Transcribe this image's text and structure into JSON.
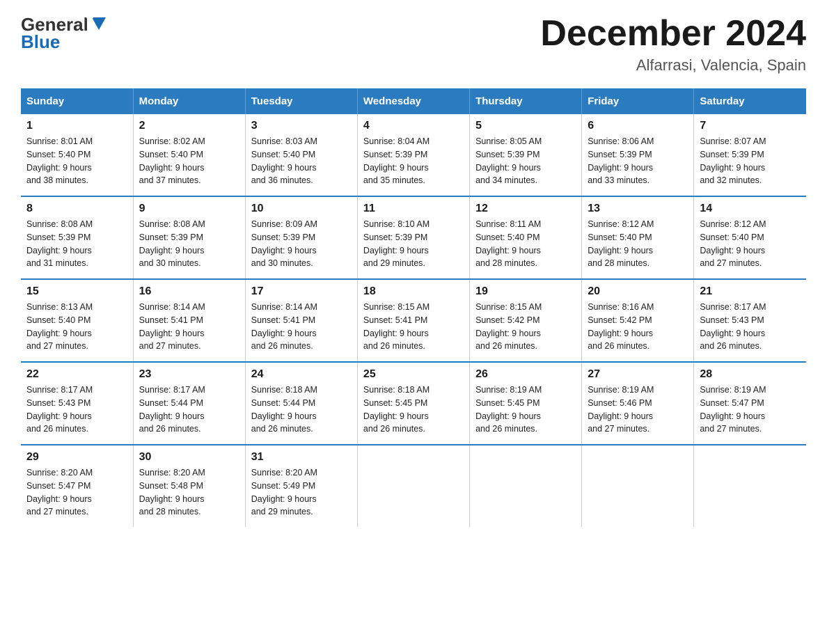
{
  "logo": {
    "general": "General",
    "blue": "Blue"
  },
  "title": {
    "month_year": "December 2024",
    "location": "Alfarrasi, Valencia, Spain"
  },
  "days_of_week": [
    "Sunday",
    "Monday",
    "Tuesday",
    "Wednesday",
    "Thursday",
    "Friday",
    "Saturday"
  ],
  "weeks": [
    [
      {
        "day": "1",
        "sunrise": "8:01 AM",
        "sunset": "5:40 PM",
        "daylight": "9 hours and 38 minutes."
      },
      {
        "day": "2",
        "sunrise": "8:02 AM",
        "sunset": "5:40 PM",
        "daylight": "9 hours and 37 minutes."
      },
      {
        "day": "3",
        "sunrise": "8:03 AM",
        "sunset": "5:40 PM",
        "daylight": "9 hours and 36 minutes."
      },
      {
        "day": "4",
        "sunrise": "8:04 AM",
        "sunset": "5:39 PM",
        "daylight": "9 hours and 35 minutes."
      },
      {
        "day": "5",
        "sunrise": "8:05 AM",
        "sunset": "5:39 PM",
        "daylight": "9 hours and 34 minutes."
      },
      {
        "day": "6",
        "sunrise": "8:06 AM",
        "sunset": "5:39 PM",
        "daylight": "9 hours and 33 minutes."
      },
      {
        "day": "7",
        "sunrise": "8:07 AM",
        "sunset": "5:39 PM",
        "daylight": "9 hours and 32 minutes."
      }
    ],
    [
      {
        "day": "8",
        "sunrise": "8:08 AM",
        "sunset": "5:39 PM",
        "daylight": "9 hours and 31 minutes."
      },
      {
        "day": "9",
        "sunrise": "8:08 AM",
        "sunset": "5:39 PM",
        "daylight": "9 hours and 30 minutes."
      },
      {
        "day": "10",
        "sunrise": "8:09 AM",
        "sunset": "5:39 PM",
        "daylight": "9 hours and 30 minutes."
      },
      {
        "day": "11",
        "sunrise": "8:10 AM",
        "sunset": "5:39 PM",
        "daylight": "9 hours and 29 minutes."
      },
      {
        "day": "12",
        "sunrise": "8:11 AM",
        "sunset": "5:40 PM",
        "daylight": "9 hours and 28 minutes."
      },
      {
        "day": "13",
        "sunrise": "8:12 AM",
        "sunset": "5:40 PM",
        "daylight": "9 hours and 28 minutes."
      },
      {
        "day": "14",
        "sunrise": "8:12 AM",
        "sunset": "5:40 PM",
        "daylight": "9 hours and 27 minutes."
      }
    ],
    [
      {
        "day": "15",
        "sunrise": "8:13 AM",
        "sunset": "5:40 PM",
        "daylight": "9 hours and 27 minutes."
      },
      {
        "day": "16",
        "sunrise": "8:14 AM",
        "sunset": "5:41 PM",
        "daylight": "9 hours and 27 minutes."
      },
      {
        "day": "17",
        "sunrise": "8:14 AM",
        "sunset": "5:41 PM",
        "daylight": "9 hours and 26 minutes."
      },
      {
        "day": "18",
        "sunrise": "8:15 AM",
        "sunset": "5:41 PM",
        "daylight": "9 hours and 26 minutes."
      },
      {
        "day": "19",
        "sunrise": "8:15 AM",
        "sunset": "5:42 PM",
        "daylight": "9 hours and 26 minutes."
      },
      {
        "day": "20",
        "sunrise": "8:16 AM",
        "sunset": "5:42 PM",
        "daylight": "9 hours and 26 minutes."
      },
      {
        "day": "21",
        "sunrise": "8:17 AM",
        "sunset": "5:43 PM",
        "daylight": "9 hours and 26 minutes."
      }
    ],
    [
      {
        "day": "22",
        "sunrise": "8:17 AM",
        "sunset": "5:43 PM",
        "daylight": "9 hours and 26 minutes."
      },
      {
        "day": "23",
        "sunrise": "8:17 AM",
        "sunset": "5:44 PM",
        "daylight": "9 hours and 26 minutes."
      },
      {
        "day": "24",
        "sunrise": "8:18 AM",
        "sunset": "5:44 PM",
        "daylight": "9 hours and 26 minutes."
      },
      {
        "day": "25",
        "sunrise": "8:18 AM",
        "sunset": "5:45 PM",
        "daylight": "9 hours and 26 minutes."
      },
      {
        "day": "26",
        "sunrise": "8:19 AM",
        "sunset": "5:45 PM",
        "daylight": "9 hours and 26 minutes."
      },
      {
        "day": "27",
        "sunrise": "8:19 AM",
        "sunset": "5:46 PM",
        "daylight": "9 hours and 27 minutes."
      },
      {
        "day": "28",
        "sunrise": "8:19 AM",
        "sunset": "5:47 PM",
        "daylight": "9 hours and 27 minutes."
      }
    ],
    [
      {
        "day": "29",
        "sunrise": "8:20 AM",
        "sunset": "5:47 PM",
        "daylight": "9 hours and 27 minutes."
      },
      {
        "day": "30",
        "sunrise": "8:20 AM",
        "sunset": "5:48 PM",
        "daylight": "9 hours and 28 minutes."
      },
      {
        "day": "31",
        "sunrise": "8:20 AM",
        "sunset": "5:49 PM",
        "daylight": "9 hours and 29 minutes."
      },
      null,
      null,
      null,
      null
    ]
  ],
  "labels": {
    "sunrise": "Sunrise:",
    "sunset": "Sunset:",
    "daylight": "Daylight:"
  }
}
